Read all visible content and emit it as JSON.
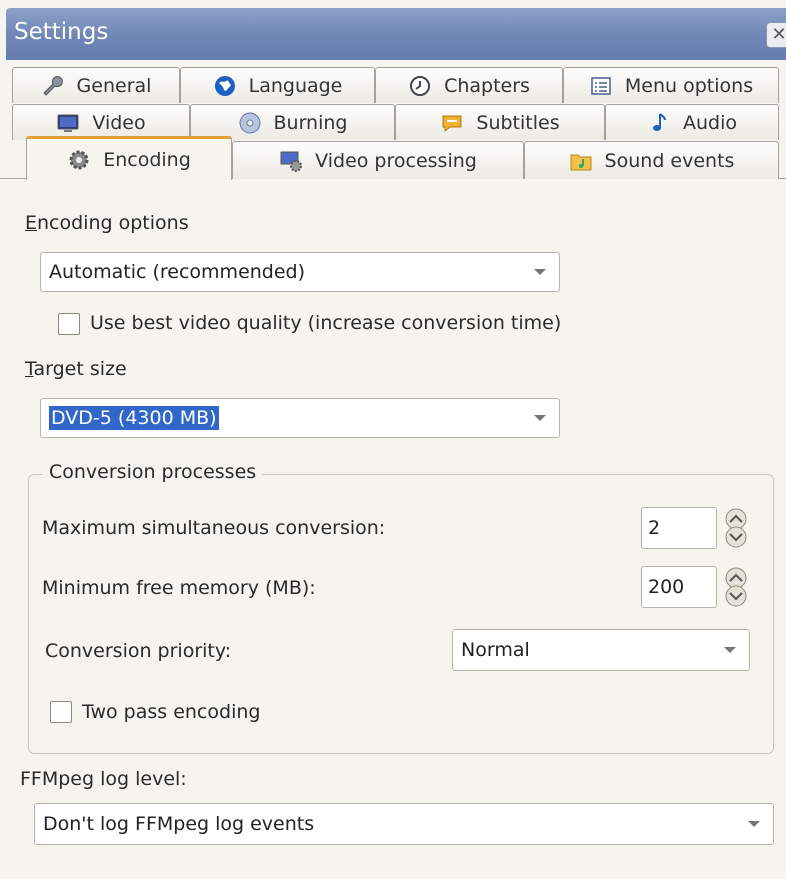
{
  "window": {
    "title": "Settings",
    "close_glyph": "✕"
  },
  "tabs": {
    "row1": [
      {
        "label": "General",
        "icon": "wrench-icon"
      },
      {
        "label": "Language",
        "icon": "globe-icon"
      },
      {
        "label": "Chapters",
        "icon": "clock-icon"
      },
      {
        "label": "Menu options",
        "icon": "menu-list-icon"
      }
    ],
    "row2": [
      {
        "label": "Video",
        "icon": "monitor-icon"
      },
      {
        "label": "Burning",
        "icon": "disc-icon"
      },
      {
        "label": "Subtitles",
        "icon": "speech-bubble-icon"
      },
      {
        "label": "Audio",
        "icon": "music-note-icon"
      }
    ],
    "row3": [
      {
        "label": "Encoding",
        "icon": "gear-icon",
        "active": true
      },
      {
        "label": "Video processing",
        "icon": "monitor-gear-icon"
      },
      {
        "label": "Sound events",
        "icon": "music-folder-icon"
      }
    ]
  },
  "encoding": {
    "options_label_accel": "E",
    "options_label_rest": "ncoding options",
    "options_value": "Automatic (recommended)",
    "best_quality_label": "Use best video quality (increase conversion time)",
    "best_quality_checked": false,
    "target_label_accel": "T",
    "target_label_rest": "arget size",
    "target_value": "DVD-5 (4300 MB)"
  },
  "conversion": {
    "legend": "Conversion processes",
    "max_sim_label": "Maximum simultaneous conversion:",
    "max_sim_value": "2",
    "min_mem_label": "Minimum free memory (MB):",
    "min_mem_value": "200",
    "priority_label": "Conversion priority:",
    "priority_value": "Normal",
    "two_pass_label": "Two pass encoding",
    "two_pass_checked": false
  },
  "ffmpeg": {
    "label": "FFMpeg log level:",
    "value": "Don't log FFMpeg log events"
  },
  "colors": {
    "title_bar": "#6f86b6",
    "selection": "#3167c9",
    "active_tab_accent": "#e0a030"
  }
}
